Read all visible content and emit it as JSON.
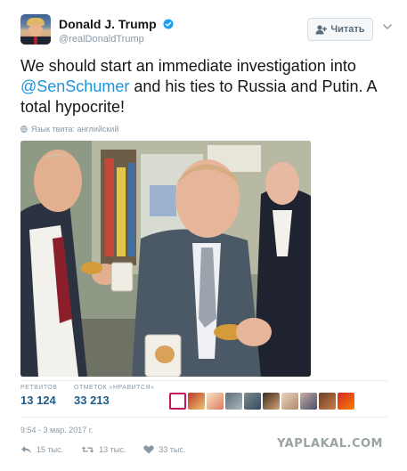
{
  "tweet": {
    "author": {
      "display_name": "Donald J. Trump",
      "handle": "@realDonaldTrump",
      "verified": true
    },
    "follow_button": {
      "label": "Читать",
      "icon": "add-user-icon"
    },
    "text": {
      "part1": "We should start an immediate investigation into ",
      "mention": "@SenSchumer",
      "part2": " and his ties to Russia and Putin. A total hypocrite!"
    },
    "language_note": "Язык твита: английский",
    "stats": {
      "retweets_label": "РЕТВИТОВ",
      "retweets_value": "13 124",
      "likes_label": "ОТМЕТОК «НРАВИТСЯ»",
      "likes_value": "33 213"
    },
    "timestamp": "9:54 - 3 мар. 2017 г.",
    "actions": {
      "replies": "15 тыс.",
      "retweets": "13 тыс.",
      "likes": "33 тыс."
    }
  },
  "watermark": "YAPLAKAL.COM",
  "colors": {
    "accent": "#1b95e0",
    "stat_value": "#1b5c8a",
    "muted": "#8899a6"
  }
}
